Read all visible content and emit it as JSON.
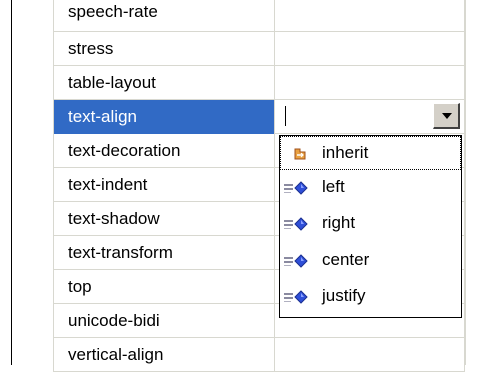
{
  "property_grid": {
    "rows": [
      {
        "name": "speech-rate",
        "value": ""
      },
      {
        "name": "stress",
        "value": ""
      },
      {
        "name": "table-layout",
        "value": ""
      },
      {
        "name": "text-align",
        "value": "",
        "selected": true
      },
      {
        "name": "text-decoration",
        "value": ""
      },
      {
        "name": "text-indent",
        "value": ""
      },
      {
        "name": "text-shadow",
        "value": ""
      },
      {
        "name": "text-transform",
        "value": ""
      },
      {
        "name": "top",
        "value": ""
      },
      {
        "name": "unicode-bidi",
        "value": ""
      },
      {
        "name": "vertical-align",
        "value": ""
      }
    ]
  },
  "value_editor": {
    "current_value": "",
    "options": [
      {
        "label": "inherit",
        "icon": "inherit-icon",
        "focused": true
      },
      {
        "label": "left",
        "icon": "enum-value-icon"
      },
      {
        "label": "right",
        "icon": "enum-value-icon"
      },
      {
        "label": "center",
        "icon": "enum-value-icon"
      },
      {
        "label": "justify",
        "icon": "enum-value-icon"
      }
    ]
  },
  "colors": {
    "selection": "#316ac5",
    "selection_text": "#ffffff",
    "grid_line": "#d8d8d0",
    "button_face": "#d4d0c8",
    "enum_diamond": "#2f4fd8",
    "inherit_icon": "#d46a1a"
  }
}
